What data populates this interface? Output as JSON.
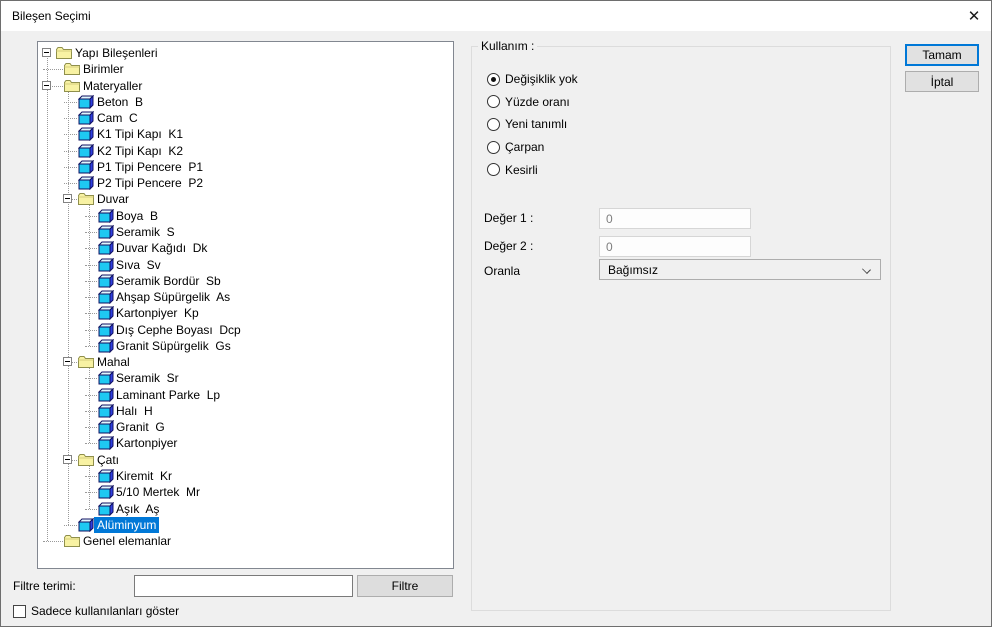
{
  "window": {
    "title": "Bileşen Seçimi",
    "close_icon": "✕"
  },
  "tree": {
    "rows": [
      {
        "label": "Yapı Bileşenleri",
        "level": 0,
        "icon": "folder",
        "expander": "minus",
        "selected": false
      },
      {
        "label": "Birimler",
        "level": 1,
        "icon": "folder",
        "expander": null,
        "selected": false
      },
      {
        "label": "Materyaller",
        "level": 1,
        "icon": "folder",
        "expander": "minus",
        "selected": false
      },
      {
        "label": "Beton  B",
        "level": 2,
        "icon": "cube",
        "expander": null,
        "selected": false
      },
      {
        "label": "Cam  C",
        "level": 2,
        "icon": "cube",
        "expander": null,
        "selected": false
      },
      {
        "label": "K1 Tipi Kapı  K1",
        "level": 2,
        "icon": "cube",
        "expander": null,
        "selected": false
      },
      {
        "label": "K2 Tipi Kapı  K2",
        "level": 2,
        "icon": "cube",
        "expander": null,
        "selected": false
      },
      {
        "label": "P1 Tipi Pencere  P1",
        "level": 2,
        "icon": "cube",
        "expander": null,
        "selected": false
      },
      {
        "label": "P2 Tipi Pencere  P2",
        "level": 2,
        "icon": "cube",
        "expander": null,
        "selected": false
      },
      {
        "label": "Duvar",
        "level": 2,
        "icon": "folder",
        "expander": "minus",
        "selected": false
      },
      {
        "label": "Boya  B",
        "level": 3,
        "icon": "cube",
        "expander": null,
        "selected": false
      },
      {
        "label": "Seramik  S",
        "level": 3,
        "icon": "cube",
        "expander": null,
        "selected": false
      },
      {
        "label": "Duvar Kağıdı  Dk",
        "level": 3,
        "icon": "cube",
        "expander": null,
        "selected": false
      },
      {
        "label": "Sıva  Sv",
        "level": 3,
        "icon": "cube",
        "expander": null,
        "selected": false
      },
      {
        "label": "Seramik Bordür  Sb",
        "level": 3,
        "icon": "cube",
        "expander": null,
        "selected": false
      },
      {
        "label": "Ahşap Süpürgelik  As",
        "level": 3,
        "icon": "cube",
        "expander": null,
        "selected": false
      },
      {
        "label": "Kartonpiyer  Kp",
        "level": 3,
        "icon": "cube",
        "expander": null,
        "selected": false
      },
      {
        "label": "Dış Cephe Boyası  Dcp",
        "level": 3,
        "icon": "cube",
        "expander": null,
        "selected": false
      },
      {
        "label": "Granit Süpürgelik  Gs",
        "level": 3,
        "icon": "cube",
        "expander": null,
        "selected": false
      },
      {
        "label": "Mahal",
        "level": 2,
        "icon": "folder",
        "expander": "minus",
        "selected": false
      },
      {
        "label": "Seramik  Sr",
        "level": 3,
        "icon": "cube",
        "expander": null,
        "selected": false
      },
      {
        "label": "Laminant Parke  Lp",
        "level": 3,
        "icon": "cube",
        "expander": null,
        "selected": false
      },
      {
        "label": "Halı  H",
        "level": 3,
        "icon": "cube",
        "expander": null,
        "selected": false
      },
      {
        "label": "Granit  G",
        "level": 3,
        "icon": "cube",
        "expander": null,
        "selected": false
      },
      {
        "label": "Kartonpiyer",
        "level": 3,
        "icon": "cube",
        "expander": null,
        "selected": false
      },
      {
        "label": "Çatı",
        "level": 2,
        "icon": "folder",
        "expander": "minus",
        "selected": false
      },
      {
        "label": "Kiremit  Kr",
        "level": 3,
        "icon": "cube",
        "expander": null,
        "selected": false
      },
      {
        "label": "5/10 Mertek  Mr",
        "level": 3,
        "icon": "cube",
        "expander": null,
        "selected": false
      },
      {
        "label": "Aşık  Aş",
        "level": 3,
        "icon": "cube",
        "expander": null,
        "selected": false
      },
      {
        "label": "Alüminyum",
        "level": 2,
        "icon": "cube",
        "expander": null,
        "selected": true
      },
      {
        "label": "Genel elemanlar",
        "level": 1,
        "icon": "folder",
        "expander": null,
        "selected": false
      }
    ]
  },
  "usage": {
    "group_label": "Kullanım :",
    "radios": [
      {
        "label": "Değişiklik yok",
        "selected": true
      },
      {
        "label": "Yüzde oranı",
        "selected": false
      },
      {
        "label": "Yeni tanımlı",
        "selected": false
      },
      {
        "label": "Çarpan",
        "selected": false
      },
      {
        "label": "Kesirli",
        "selected": false
      }
    ],
    "fields": [
      {
        "label": "Değer 1 :",
        "value": "0",
        "disabled": true
      },
      {
        "label": "Değer 2 :",
        "value": "0",
        "disabled": true
      }
    ],
    "ratio_label": "Oranla",
    "ratio_value": "Bağımsız"
  },
  "buttons": {
    "ok": "Tamam",
    "cancel": "İptal"
  },
  "filter": {
    "label": "Filtre terimi:",
    "input_value": "",
    "button": "Filtre",
    "checkbox_label": "Sadece kullanılanları göster",
    "checkbox_checked": false
  },
  "colors": {
    "selection": "#0078d7",
    "default_button_border": "#0078d7",
    "folder_fill": "#f8f2a3",
    "cube_front": "#1ec9f2",
    "dialog_bg": "#f0f0f0"
  }
}
